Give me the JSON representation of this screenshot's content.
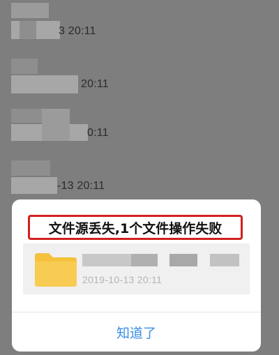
{
  "background": {
    "items": [
      {
        "time": "3 20:11"
      },
      {
        "time": "20:11"
      },
      {
        "time": "0:11"
      },
      {
        "time": "-13 20:11"
      }
    ]
  },
  "dialog": {
    "title": "文件源丢失,1个文件操作失败",
    "file": {
      "icon": "folder-icon",
      "time": "2019-10-13 20:11"
    },
    "ok_label": "知道了"
  },
  "colors": {
    "overlay": "#7e7e7e",
    "highlight_border": "#d21f1f",
    "folder": "#f5c13d",
    "link": "#3a8ee6"
  }
}
